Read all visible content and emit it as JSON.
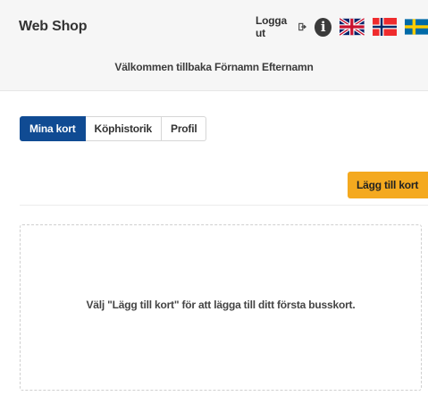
{
  "header": {
    "brand": "Web Shop",
    "logout_label": "Logga ut",
    "welcome_text": "Välkommen tillbaka Förnamn Efternamn"
  },
  "tabs": [
    {
      "label": "Mina kort",
      "active": true
    },
    {
      "label": "Köphistorik",
      "active": false
    },
    {
      "label": "Profil",
      "active": false
    }
  ],
  "actions": {
    "add_card_label": "Lägg till kort"
  },
  "empty_state": {
    "message": "Välj \"Lägg till kort\" för att lägga till ditt första busskort."
  },
  "colors": {
    "header_bg": "#f6f6f6",
    "active_tab": "#104b93",
    "add_button": "#f4a91f"
  },
  "icons": {
    "logout": "logout-arrow-icon",
    "info": "info-icon",
    "flags": [
      "uk-flag-icon",
      "norway-flag-icon",
      "sweden-flag-icon"
    ]
  }
}
